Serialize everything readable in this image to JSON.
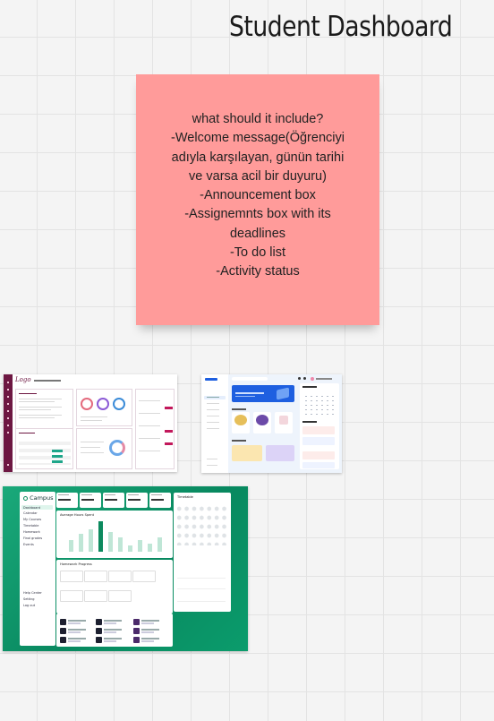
{
  "board": {
    "title": "Student Dashboard"
  },
  "sticky_note": {
    "lines": [
      "what should it include?",
      "-Welcome message(Öğrenciyi",
      "adıyla karşılayan, günün tarihi",
      "ve varsa acil bir duyuru)",
      "-Announcement box",
      "-Assignemnts box with its",
      "deadlines",
      "-To do list",
      "-Activity status"
    ],
    "color": "#ff9b9a"
  },
  "thumbnails": {
    "dashboard_1": {
      "logo": "Logo",
      "accent_color": "#6d1742",
      "icon": "dashboard-screenshot"
    },
    "dashboard_2": {
      "accent_color": "#1e5fe0",
      "icon": "dashboard-screenshot"
    },
    "dashboard_3": {
      "logo": "Campus",
      "menu": [
        "Dashboard",
        "Calendar",
        "My Courses",
        "Timetable",
        "Homework",
        "Final grades",
        "Events"
      ],
      "bottom_menu": [
        "Help Center",
        "Setting",
        "Log out"
      ],
      "chart_title": "Average Hours Spent",
      "panel_title": "Homework Progress",
      "calendar_title": "Timetable",
      "accent_color": "#0c8a5e",
      "bar_levels": [
        0.35,
        0.55,
        0.7,
        0.95,
        0.6,
        0.45,
        0.2,
        0.35,
        0.25,
        0.45
      ],
      "icon": "dashboard-screenshot"
    }
  }
}
